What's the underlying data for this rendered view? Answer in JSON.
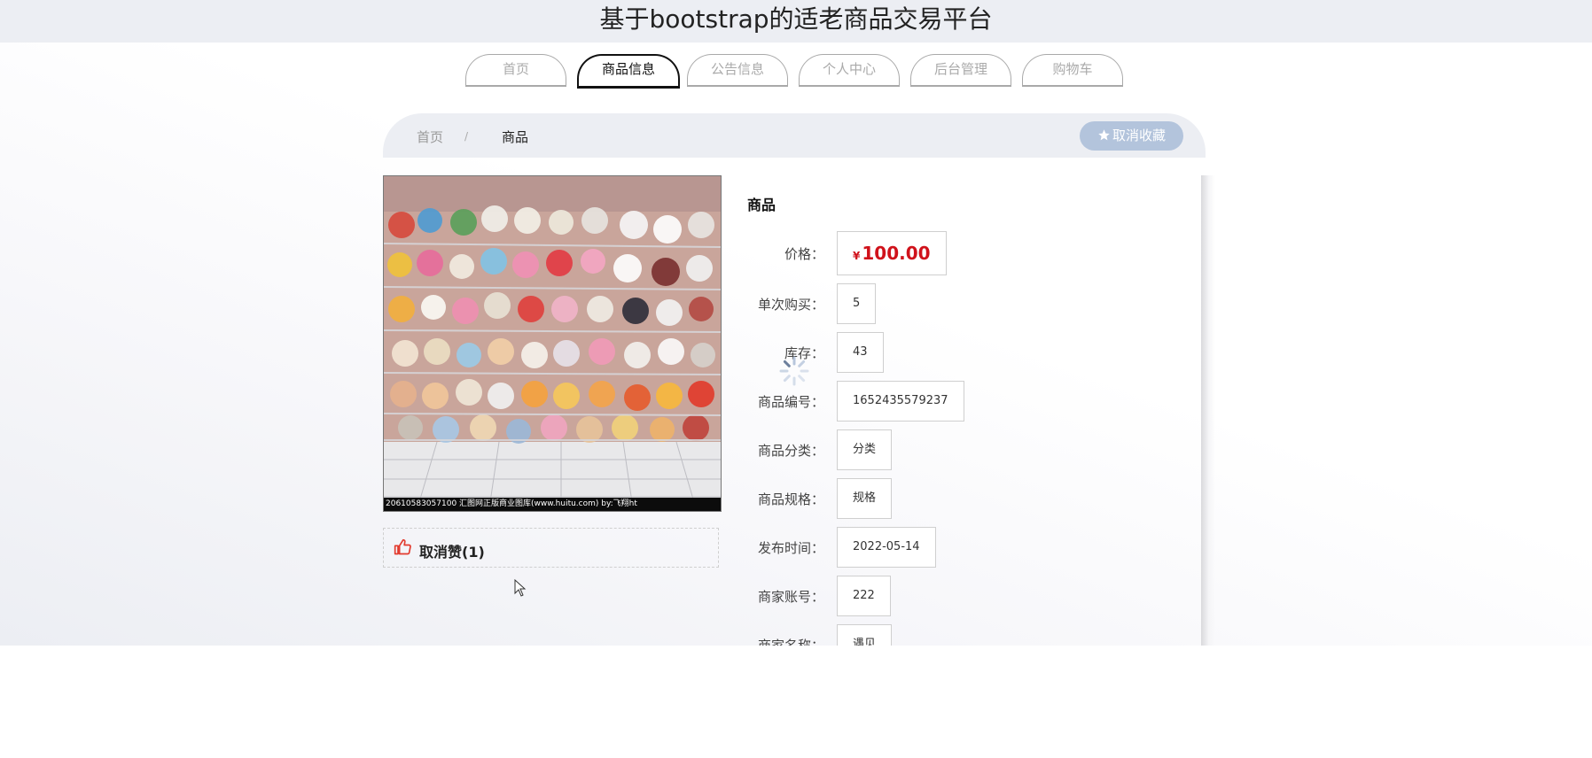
{
  "header": {
    "title": "基于bootstrap的适老商品交易平台"
  },
  "nav": {
    "tabs": [
      {
        "label": "首页"
      },
      {
        "label": "商品信息"
      },
      {
        "label": "公告信息"
      },
      {
        "label": "个人中心"
      },
      {
        "label": "后台管理"
      },
      {
        "label": "购物车"
      }
    ],
    "active_index": 1
  },
  "breadcrumb": {
    "home": "首页",
    "separator": "/",
    "current": "商品"
  },
  "favorite_button": {
    "label": "取消收藏",
    "icon": "star-icon"
  },
  "product": {
    "name": "商品",
    "image_caption": "20610583057100 汇图网正版商业图库(www.huitu.com) by:飞翔ht",
    "like_label": "取消赞(1)",
    "like_icon": "thumbs-up-icon",
    "fields": [
      {
        "label": "价格：",
        "currency": "¥",
        "value": "100.00"
      },
      {
        "label": "单次购买：",
        "value": "5"
      },
      {
        "label": "库存：",
        "value": "43"
      },
      {
        "label": "商品编号：",
        "value": "1652435579237"
      },
      {
        "label": "商品分类：",
        "value": "分类"
      },
      {
        "label": "商品规格：",
        "value": "规格"
      },
      {
        "label": "发布时间：",
        "value": "2022-05-14"
      },
      {
        "label": "商家账号：",
        "value": "222"
      },
      {
        "label": "商家名称：",
        "value": "遇见"
      }
    ]
  },
  "colors": {
    "accent_price": "#d0121b",
    "favorite_button_bg": "#b3c4dc",
    "like_icon": "#e23a2e",
    "header_bg": "#eceef3"
  }
}
